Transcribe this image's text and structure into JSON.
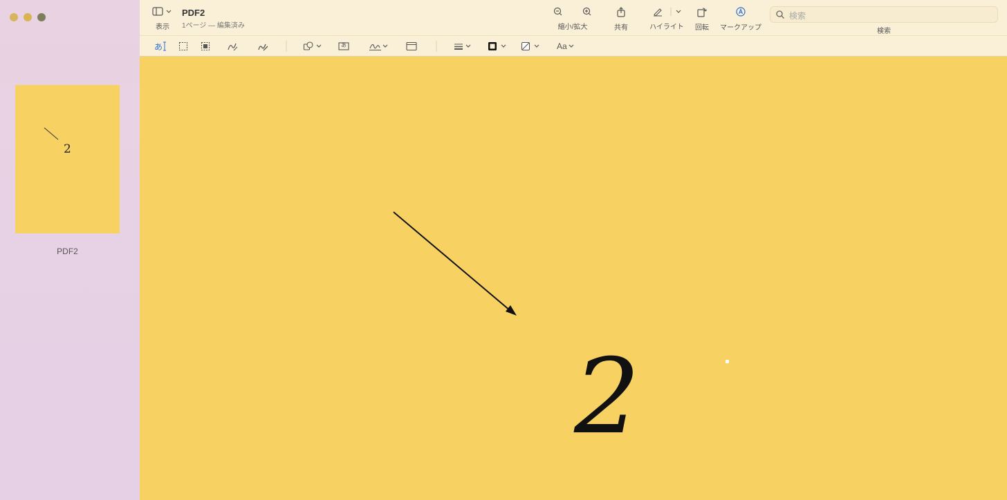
{
  "window": {
    "title": "PDF2",
    "subtitle": "1ページ — 編集済み"
  },
  "toolbar": {
    "view_label": "表示",
    "zoom_label": "縮小/拡大",
    "share_label": "共有",
    "highlight_label": "ハイライト",
    "rotate_label": "回転",
    "markup_label": "マークアップ",
    "search_label": "検索",
    "search_placeholder": "検索"
  },
  "markup_tools": {
    "text_selection_glyph": "あ",
    "text_box_glyph": "あ",
    "font_label": "Aa"
  },
  "sidebar": {
    "thumbnail_label": "PDF2",
    "thumbnail_number": "2"
  },
  "document": {
    "page_number": "2"
  },
  "colors": {
    "page_background": "#f7d262",
    "toolbar_background": "#faf0d8",
    "accent": "#2a6fd6"
  }
}
